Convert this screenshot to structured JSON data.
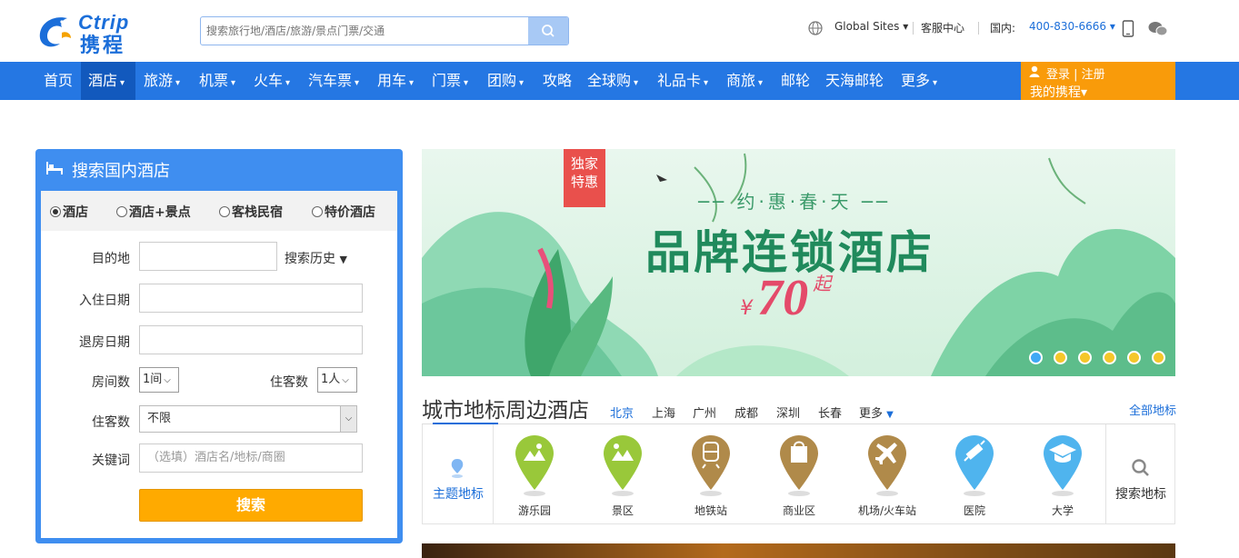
{
  "header": {
    "logo_text": "Ctrip",
    "logo_cn": "携程",
    "search_placeholder": "搜索旅行地/酒店/旅游/景点门票/交通",
    "global_sites": "Global Sites",
    "customer_service": "客服中心",
    "domestic_label": "国内:",
    "phone": "400-830-6666"
  },
  "nav": {
    "items": [
      "首页",
      "酒店",
      "旅游",
      "机票",
      "火车",
      "汽车票",
      "用车",
      "门票",
      "团购",
      "攻略",
      "全球购",
      "礼品卡",
      "商旅",
      "邮轮",
      "天海邮轮",
      "更多"
    ],
    "login": "登录 | 注册",
    "my_ctrip": "我的携程"
  },
  "panel": {
    "title": "搜索国内酒店",
    "types": [
      "酒店",
      "酒店+景点",
      "客栈民宿",
      "特价酒店"
    ],
    "destination_label": "目的地",
    "search_history": "搜索历史",
    "checkin_label": "入住日期",
    "checkout_label": "退房日期",
    "rooms_label": "房间数",
    "rooms_value": "1间",
    "guests_label": "住客数",
    "guests_value": "1人",
    "guest_type_label": "住客数",
    "guest_type_value": "不限",
    "keyword_label": "关键词",
    "keyword_placeholder": "（选填）酒店名/地标/商圈",
    "submit": "搜索"
  },
  "banner": {
    "badge_line1": "独家",
    "badge_line2": "特惠",
    "subtitle": "约·惠·春·天",
    "headline": "品牌连锁酒店",
    "currency": "¥",
    "price": "70",
    "suffix": "起",
    "slide_count": 6,
    "active_slide": 0
  },
  "landmarks": {
    "title": "城市地标周边酒店",
    "cities": [
      "北京",
      "上海",
      "广州",
      "成都",
      "深圳",
      "长春"
    ],
    "more": "更多",
    "all": "全部地标",
    "theme": "主题地标",
    "pois": [
      "游乐园",
      "景区",
      "地铁站",
      "商业区",
      "机场/火车站",
      "医院",
      "大学"
    ],
    "search_poi": "搜索地标"
  },
  "colors": {
    "brand_blue": "#2577e3",
    "login_orange": "#f99b0a",
    "submit_orange": "#ffaa00"
  }
}
